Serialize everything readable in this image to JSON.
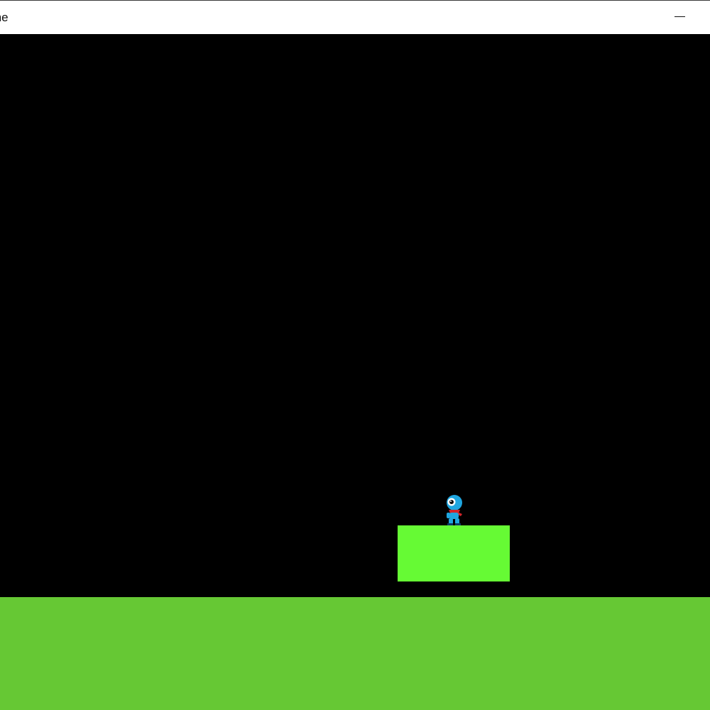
{
  "window": {
    "title": "me",
    "minimize_icon": "minimize-icon"
  },
  "game": {
    "background_color": "#000000",
    "ground_color": "#66c834",
    "platform_color": "#66fa34",
    "player": {
      "sprite": "blue-round-character",
      "body_color": "#1fa6e0",
      "scarf_color": "#d3242a"
    }
  }
}
